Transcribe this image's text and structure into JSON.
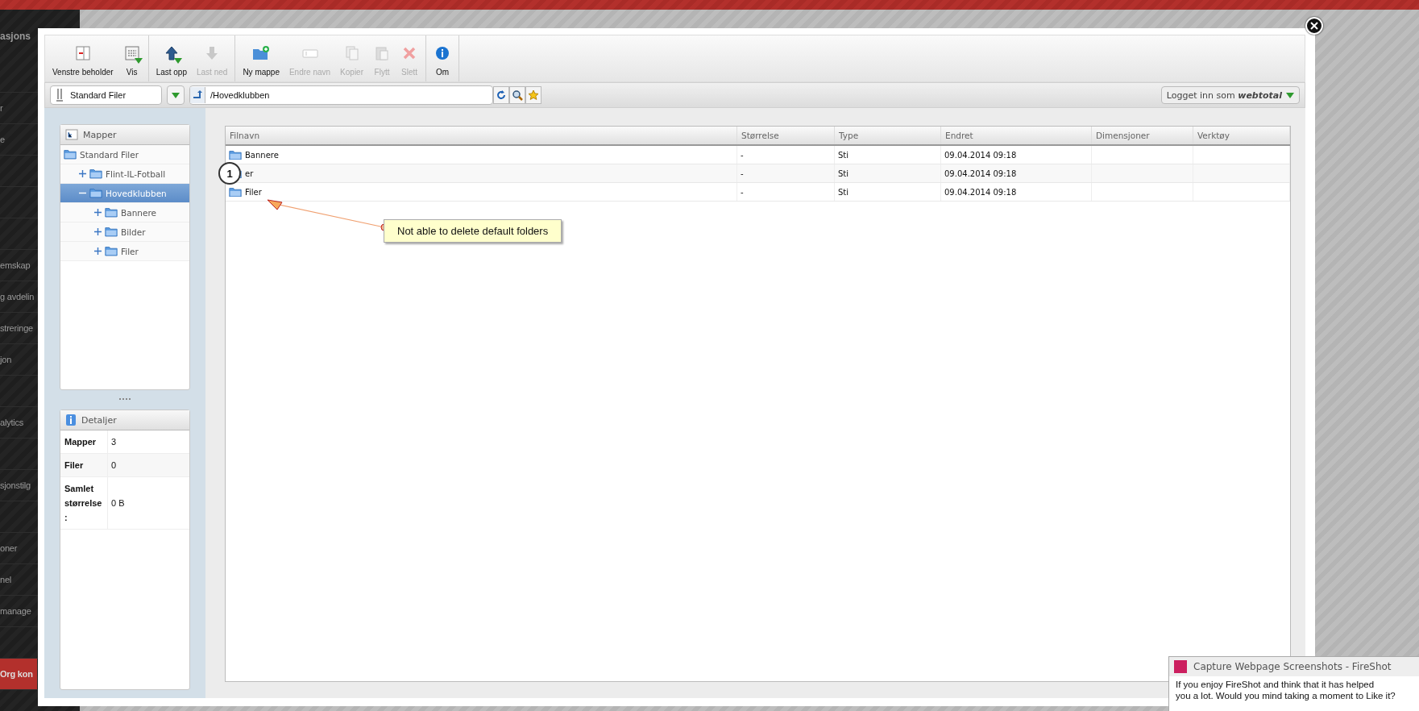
{
  "background_sidebar": {
    "header": "asjons",
    "items": [
      {
        "label": "r",
        "selected": false
      },
      {
        "label": "e",
        "selected": false
      },
      {
        "label": "emskap",
        "selected": false
      },
      {
        "label": "g avdelin",
        "selected": false
      },
      {
        "label": "streringe",
        "selected": false
      },
      {
        "label": "jon",
        "selected": false
      },
      {
        "label": "alytics",
        "selected": false
      },
      {
        "label": "sjonstilg",
        "selected": false
      },
      {
        "label": "oner",
        "selected": false
      },
      {
        "label": "nel",
        "selected": false
      },
      {
        "label": "manage",
        "selected": false
      },
      {
        "label": "Org kon",
        "selected": true
      }
    ]
  },
  "toolbar": {
    "groups": [
      [
        {
          "label": "Venstre beholder",
          "disabled": false,
          "dropdown": false
        },
        {
          "label": "Vis",
          "disabled": false,
          "dropdown": true
        }
      ],
      [
        {
          "label": "Last opp",
          "disabled": false,
          "dropdown": true
        },
        {
          "label": "Last ned",
          "disabled": true,
          "dropdown": false
        }
      ],
      [
        {
          "label": "Ny mappe",
          "disabled": false,
          "dropdown": false
        },
        {
          "label": "Endre navn",
          "disabled": true,
          "dropdown": false
        },
        {
          "label": "Kopier",
          "disabled": true,
          "dropdown": false
        },
        {
          "label": "Flytt",
          "disabled": true,
          "dropdown": false
        },
        {
          "label": "Slett",
          "disabled": true,
          "dropdown": false
        }
      ],
      [
        {
          "label": "Om",
          "disabled": false,
          "dropdown": false
        }
      ]
    ]
  },
  "address_bar": {
    "storage": "Standard Filer",
    "path": "/Hovedklubben",
    "login_prefix": "Logget inn som",
    "login_user": "webtotal"
  },
  "folders_panel": {
    "title": "Mapper",
    "tree": [
      {
        "label": "Standard Filer",
        "selected": false,
        "children": [
          {
            "label": "Flint-IL-Fotball",
            "selected": false,
            "expanded": false
          },
          {
            "label": "Hovedklubben",
            "selected": true,
            "expanded": true,
            "children": [
              {
                "label": "Bannere",
                "selected": false,
                "expanded": false
              },
              {
                "label": "Bilder",
                "selected": false,
                "expanded": false
              },
              {
                "label": "Filer",
                "selected": false,
                "expanded": false
              }
            ]
          }
        ]
      }
    ]
  },
  "details_panel": {
    "title": "Detaljer",
    "rows": [
      {
        "label": "Mapper",
        "value": "3"
      },
      {
        "label": "Filer",
        "value": "0"
      },
      {
        "label": "Samlet størrelse :",
        "value": "0 B"
      }
    ]
  },
  "table": {
    "columns": [
      "Filnavn",
      "Størrelse",
      "Type",
      "Endret",
      "Dimensjoner",
      "Verktøy"
    ],
    "rows": [
      [
        "Bannere",
        "-",
        "Sti",
        "09.04.2014 09:18"
      ],
      [
        "er",
        "-",
        "Sti",
        "09.04.2014 09:18"
      ],
      [
        "Filer",
        "-",
        "Sti",
        "09.04.2014 09:18"
      ]
    ]
  },
  "annotations": {
    "marker": "1",
    "callout": "Not able to delete default folders"
  },
  "fireshot_popup": {
    "title": "Capture Webpage Screenshots - FireShot",
    "message_lines": [
      "If you enjoy FireShot and think that it has helped",
      "you a lot. Would you mind taking a moment to Like it?"
    ]
  }
}
